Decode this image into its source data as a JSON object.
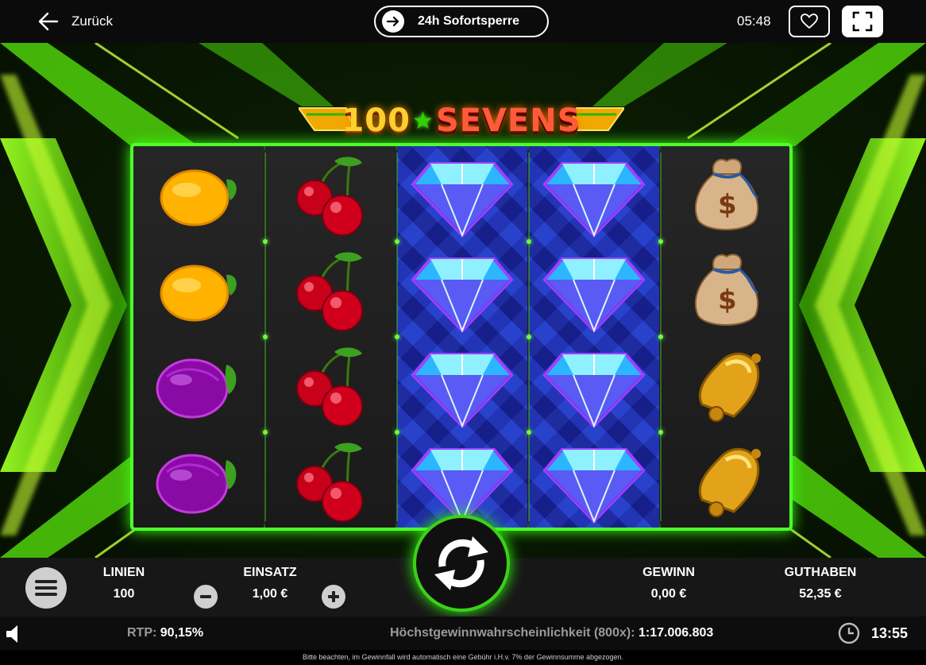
{
  "topbar": {
    "back_label": "Zurück",
    "self_exclusion_label": "24h Sofortsperre",
    "time": "05:48"
  },
  "game": {
    "logo": {
      "number": "100",
      "word": "SEVENS"
    },
    "reels": [
      [
        "lemon",
        "lemon",
        "plum",
        "plum"
      ],
      [
        "cherry",
        "cherry",
        "cherry",
        "cherry"
      ],
      [
        "diamond",
        "diamond",
        "diamond",
        "diamond"
      ],
      [
        "diamond",
        "diamond",
        "diamond",
        "diamond"
      ],
      [
        "money-bag",
        "money-bag",
        "bell",
        "bell"
      ]
    ]
  },
  "controls": {
    "lines_label": "LINIEN",
    "lines_value": "100",
    "bet_label": "EINSATZ",
    "bet_value": "1,00 €",
    "win_label": "GEWINN",
    "win_value": "0,00 €",
    "balance_label": "GUTHABEN",
    "balance_value": "52,35 €"
  },
  "info": {
    "rtp_label": "RTP:",
    "rtp_value": "90,15%",
    "probability_label": "Höchstgewinnwahrscheinlichkeit (800x):",
    "probability_value": "1:17.006.803",
    "session_time": "13:55"
  },
  "disclaimer": "Bitte beachten, im Gewinnfall wird automatisch eine Gebühr i.H.v. 7% der Gewinnsumme abgezogen.",
  "colors": {
    "accent_green": "#4eff2a",
    "reel_blue": "#1a2590",
    "logo_gold": "#ffcf2e"
  }
}
